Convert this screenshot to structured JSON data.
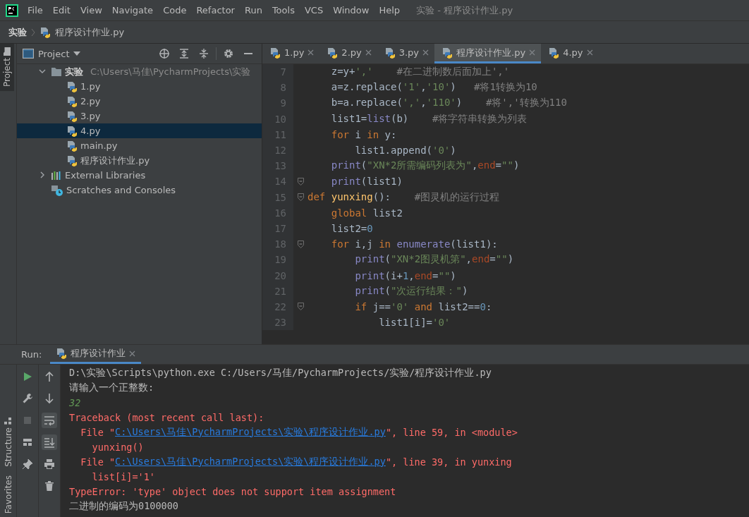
{
  "menu_bar": {
    "items": [
      "File",
      "Edit",
      "View",
      "Navigate",
      "Code",
      "Refactor",
      "Run",
      "Tools",
      "VCS",
      "Window",
      "Help"
    ],
    "title": "实验 - 程序设计作业.py"
  },
  "breadcrumb": {
    "project": "实验",
    "file": "程序设计作业.py"
  },
  "left_strip": {
    "top_tabs": [
      {
        "label": "Project",
        "selected": true
      }
    ],
    "bottom_tabs": [
      {
        "label": "Structure",
        "selected": false
      },
      {
        "label": "Favorites",
        "selected": false
      }
    ]
  },
  "project_panel": {
    "title": "Project",
    "tree": [
      {
        "name": "实验",
        "path": "C:\\Users\\马佳\\PycharmProjects\\实验",
        "kind": "folder",
        "expanded": true,
        "selected": false,
        "children": [
          {
            "name": "1.py",
            "kind": "python",
            "selected": false
          },
          {
            "name": "2.py",
            "kind": "python",
            "selected": false
          },
          {
            "name": "3.py",
            "kind": "python",
            "selected": false
          },
          {
            "name": "4.py",
            "kind": "python",
            "selected": true
          },
          {
            "name": "main.py",
            "kind": "python",
            "selected": false
          },
          {
            "name": "程序设计作业.py",
            "kind": "python",
            "selected": false
          }
        ]
      },
      {
        "name": "External Libraries",
        "kind": "libraries",
        "expanded": false,
        "selected": false
      },
      {
        "name": "Scratches and Consoles",
        "kind": "scratches",
        "selected": false
      }
    ]
  },
  "editor": {
    "tabs": [
      {
        "label": "1.py",
        "selected": false
      },
      {
        "label": "2.py",
        "selected": false
      },
      {
        "label": "3.py",
        "selected": false
      },
      {
        "label": "程序设计作业.py",
        "selected": true
      },
      {
        "label": "4.py",
        "selected": false
      }
    ],
    "lines": [
      {
        "number": "7",
        "fold": false,
        "tokens": [
          {
            "kind": "plain",
            "text": "    z=y+"
          },
          {
            "kind": "string",
            "text": "','"
          },
          {
            "kind": "comment",
            "text": "    #在二进制数后面加上','"
          }
        ]
      },
      {
        "number": "8",
        "fold": false,
        "tokens": [
          {
            "kind": "plain",
            "text": "    a=z.replace("
          },
          {
            "kind": "string",
            "text": "'1'"
          },
          {
            "kind": "plain",
            "text": ","
          },
          {
            "kind": "string",
            "text": "'10'"
          },
          {
            "kind": "plain",
            "text": ")"
          },
          {
            "kind": "comment",
            "text": "   #将1转换为10"
          }
        ]
      },
      {
        "number": "9",
        "fold": false,
        "tokens": [
          {
            "kind": "plain",
            "text": "    b=a.replace("
          },
          {
            "kind": "string",
            "text": "','"
          },
          {
            "kind": "plain",
            "text": ","
          },
          {
            "kind": "string",
            "text": "'110'"
          },
          {
            "kind": "plain",
            "text": ")"
          },
          {
            "kind": "comment",
            "text": "    #将','转换为110"
          }
        ]
      },
      {
        "number": "10",
        "fold": false,
        "tokens": [
          {
            "kind": "plain",
            "text": "    list1="
          },
          {
            "kind": "builtin",
            "text": "list"
          },
          {
            "kind": "plain",
            "text": "(b)"
          },
          {
            "kind": "comment",
            "text": "    #将字符串转换为列表"
          }
        ]
      },
      {
        "number": "11",
        "fold": false,
        "tokens": [
          {
            "kind": "keyword",
            "text": "    for"
          },
          {
            "kind": "plain",
            "text": " i "
          },
          {
            "kind": "keyword",
            "text": "in"
          },
          {
            "kind": "plain",
            "text": " y:"
          }
        ]
      },
      {
        "number": "12",
        "fold": false,
        "tokens": [
          {
            "kind": "plain",
            "text": "        list1.append("
          },
          {
            "kind": "string",
            "text": "'0'"
          },
          {
            "kind": "plain",
            "text": ")"
          }
        ]
      },
      {
        "number": "13",
        "fold": false,
        "tokens": [
          {
            "kind": "builtin",
            "text": "    print"
          },
          {
            "kind": "plain",
            "text": "("
          },
          {
            "kind": "string",
            "text": "\"XN*2所需编码列表为\""
          },
          {
            "kind": "plain",
            "text": ","
          },
          {
            "kind": "kwarg",
            "text": "end"
          },
          {
            "kind": "plain",
            "text": "="
          },
          {
            "kind": "string",
            "text": "\"\""
          },
          {
            "kind": "plain",
            "text": ")"
          }
        ]
      },
      {
        "number": "14",
        "fold": true,
        "tokens": [
          {
            "kind": "builtin",
            "text": "    print"
          },
          {
            "kind": "plain",
            "text": "(list1)"
          }
        ]
      },
      {
        "number": "15",
        "fold": true,
        "tokens": [
          {
            "kind": "keyword",
            "text": "def"
          },
          {
            "kind": "function",
            "text": " yunxing"
          },
          {
            "kind": "plain",
            "text": "():"
          },
          {
            "kind": "comment",
            "text": "    #图灵机的运行过程"
          }
        ]
      },
      {
        "number": "16",
        "fold": false,
        "tokens": [
          {
            "kind": "keyword",
            "text": "    global"
          },
          {
            "kind": "plain",
            "text": " list2"
          }
        ]
      },
      {
        "number": "17",
        "fold": false,
        "tokens": [
          {
            "kind": "plain",
            "text": "    list2="
          },
          {
            "kind": "number",
            "text": "0"
          }
        ]
      },
      {
        "number": "18",
        "fold": true,
        "tokens": [
          {
            "kind": "keyword",
            "text": "    for"
          },
          {
            "kind": "plain",
            "text": " i,j "
          },
          {
            "kind": "keyword",
            "text": "in"
          },
          {
            "kind": "builtin",
            "text": " enumerate"
          },
          {
            "kind": "plain",
            "text": "(list1):"
          }
        ]
      },
      {
        "number": "19",
        "fold": false,
        "tokens": [
          {
            "kind": "builtin",
            "text": "        print"
          },
          {
            "kind": "plain",
            "text": "("
          },
          {
            "kind": "string",
            "text": "\"XN*2图灵机第\""
          },
          {
            "kind": "plain",
            "text": ","
          },
          {
            "kind": "kwarg",
            "text": "end"
          },
          {
            "kind": "plain",
            "text": "="
          },
          {
            "kind": "string",
            "text": "\"\""
          },
          {
            "kind": "plain",
            "text": ")"
          }
        ]
      },
      {
        "number": "20",
        "fold": false,
        "tokens": [
          {
            "kind": "builtin",
            "text": "        print"
          },
          {
            "kind": "plain",
            "text": "(i+"
          },
          {
            "kind": "number",
            "text": "1"
          },
          {
            "kind": "plain",
            "text": ","
          },
          {
            "kind": "kwarg",
            "text": "end"
          },
          {
            "kind": "plain",
            "text": "="
          },
          {
            "kind": "string",
            "text": "\"\""
          },
          {
            "kind": "plain",
            "text": ")"
          }
        ]
      },
      {
        "number": "21",
        "fold": false,
        "tokens": [
          {
            "kind": "builtin",
            "text": "        print"
          },
          {
            "kind": "plain",
            "text": "("
          },
          {
            "kind": "string",
            "text": "\"次运行结果：\""
          },
          {
            "kind": "plain",
            "text": ")"
          }
        ]
      },
      {
        "number": "22",
        "fold": true,
        "tokens": [
          {
            "kind": "keyword",
            "text": "        if"
          },
          {
            "kind": "plain",
            "text": " j=="
          },
          {
            "kind": "string",
            "text": "'0'"
          },
          {
            "kind": "keyword",
            "text": " and"
          },
          {
            "kind": "plain",
            "text": " list2=="
          },
          {
            "kind": "number",
            "text": "0"
          },
          {
            "kind": "plain",
            "text": ":"
          }
        ]
      },
      {
        "number": "23",
        "fold": false,
        "tokens": [
          {
            "kind": "plain",
            "text": "            list1[i]="
          },
          {
            "kind": "string",
            "text": "'0'"
          }
        ]
      }
    ]
  },
  "run_panel": {
    "title": "Run:",
    "tab": "程序设计作业",
    "toolbar": [
      {
        "kind": "run",
        "disabled": false
      },
      {
        "kind": "wrench",
        "disabled": false
      },
      {
        "kind": "stop",
        "disabled": true
      },
      {
        "kind": "layout",
        "disabled": false
      },
      {
        "kind": "pin",
        "disabled": false
      }
    ],
    "console_toolbar": [
      {
        "kind": "up",
        "on": false
      },
      {
        "kind": "down",
        "on": false
      },
      {
        "kind": "wrap",
        "on": true
      },
      {
        "kind": "scroll",
        "on": true
      },
      {
        "kind": "print",
        "on": false
      },
      {
        "kind": "trash",
        "on": false
      }
    ],
    "console": [
      {
        "kind": "plain",
        "segments": [
          {
            "kind": "text",
            "text": "D:\\实验\\Scripts\\python.exe C:/Users/马佳/PycharmProjects/实验/程序设计作业.py"
          }
        ]
      },
      {
        "kind": "plain",
        "segments": [
          {
            "kind": "text",
            "text": "请输入一个正整数:"
          }
        ]
      },
      {
        "kind": "input",
        "segments": [
          {
            "kind": "text",
            "text": "32"
          }
        ]
      },
      {
        "kind": "error",
        "segments": [
          {
            "kind": "text",
            "text": "Traceback (most recent call last):"
          }
        ]
      },
      {
        "kind": "error",
        "segments": [
          {
            "kind": "text",
            "text": "  File \""
          },
          {
            "kind": "link",
            "text": "C:\\Users\\马佳\\PycharmProjects\\实验\\程序设计作业.py"
          },
          {
            "kind": "text",
            "text": "\", line 59, in <module>"
          }
        ]
      },
      {
        "kind": "error",
        "segments": [
          {
            "kind": "text",
            "text": "    yunxing()"
          }
        ]
      },
      {
        "kind": "error",
        "segments": [
          {
            "kind": "text",
            "text": "  File \""
          },
          {
            "kind": "link",
            "text": "C:\\Users\\马佳\\PycharmProjects\\实验\\程序设计作业.py"
          },
          {
            "kind": "text",
            "text": "\", line 39, in yunxing"
          }
        ]
      },
      {
        "kind": "error",
        "segments": [
          {
            "kind": "text",
            "text": "    list[i]='1'"
          }
        ]
      },
      {
        "kind": "error",
        "segments": [
          {
            "kind": "text",
            "text": "TypeError: 'type' object does not support item assignment"
          }
        ]
      },
      {
        "kind": "plain",
        "segments": [
          {
            "kind": "text",
            "text": "二进制的编码为0100000"
          }
        ]
      }
    ]
  }
}
